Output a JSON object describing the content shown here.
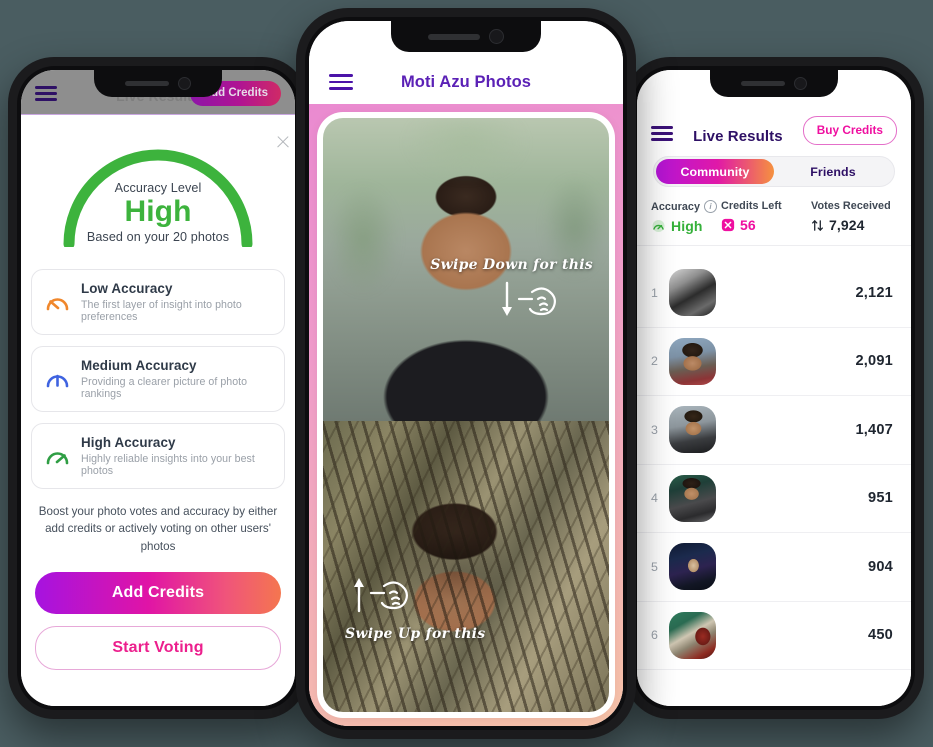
{
  "left_phone": {
    "dimmed_header": {
      "menu_icon": "hamburger-menu-icon",
      "title": "Live Results",
      "add_credits_label": "Add Credits"
    },
    "modal": {
      "close_icon": "close-icon",
      "gauge": {
        "label": "Accuracy Level",
        "value": "High",
        "subtitle": "Based on your 20 photos",
        "arc_color": "#3db33d",
        "fill_percent": 100
      },
      "accuracy_cards": [
        {
          "icon": "gauge-low-icon",
          "icon_color": "#f0872c",
          "title": "Low Accuracy",
          "description": "The first layer of insight into photo preferences"
        },
        {
          "icon": "gauge-medium-icon",
          "icon_color": "#3f63e0",
          "title": "Medium Accuracy",
          "description": "Providing a clearer picture of photo rankings"
        },
        {
          "icon": "gauge-high-icon",
          "icon_color": "#2f9e44",
          "title": "High Accuracy",
          "description": "Highly reliable insights into your best photos"
        }
      ],
      "boost_note": "Boost your photo votes and accuracy by either add credits or actively voting on other users' photos",
      "primary_button": "Add Credits",
      "secondary_button": "Start Voting"
    }
  },
  "center_phone": {
    "header": {
      "menu_icon": "hamburger-menu-icon",
      "title": "Moti Azu Photos",
      "title_color": "#5b21b6"
    },
    "photos": [
      {
        "name": "photo-top",
        "annotation": "Swipe Down for this",
        "hand_icon": "hand-pointer-icon",
        "arrow_icon": "arrow-down-icon"
      },
      {
        "name": "photo-bottom",
        "annotation": "Swipe Up for this",
        "hand_icon": "hand-pointer-icon",
        "arrow_icon": "arrow-up-icon"
      }
    ]
  },
  "right_phone": {
    "header": {
      "menu_icon": "hamburger-menu-icon",
      "title": "Live Results",
      "buy_credits_label": "Buy Credits"
    },
    "tabs": [
      {
        "label": "Community",
        "active": true
      },
      {
        "label": "Friends",
        "active": false
      }
    ],
    "stats": [
      {
        "name": "accuracy",
        "header": "Accuracy",
        "info_icon": "info-icon",
        "icon": "gauge-high-icon",
        "value": "High",
        "color": "#35b13a"
      },
      {
        "name": "credits-left",
        "header": "Credits Left",
        "icon": "credit-token-icon",
        "value": "56",
        "color": "#ef0fa0"
      },
      {
        "name": "votes-received",
        "header": "Votes Received",
        "icon": "sort-arrows-icon",
        "value": "7,924",
        "color": "#1f2630"
      }
    ],
    "results": {
      "rows": [
        {
          "rank": "1",
          "avatar": "av1",
          "votes": "2,121"
        },
        {
          "rank": "2",
          "avatar": "av2",
          "votes": "2,091"
        },
        {
          "rank": "3",
          "avatar": "av3",
          "votes": "1,407"
        },
        {
          "rank": "4",
          "avatar": "av4",
          "votes": "951"
        },
        {
          "rank": "5",
          "avatar": "av5",
          "votes": "904"
        },
        {
          "rank": "6",
          "avatar": "av6",
          "votes": "450"
        }
      ]
    }
  },
  "theme": {
    "page_background": "#4a5d61",
    "gradient_start": "#a613e0",
    "gradient_mid": "#e014a6",
    "gradient_end": "#f4764f"
  }
}
